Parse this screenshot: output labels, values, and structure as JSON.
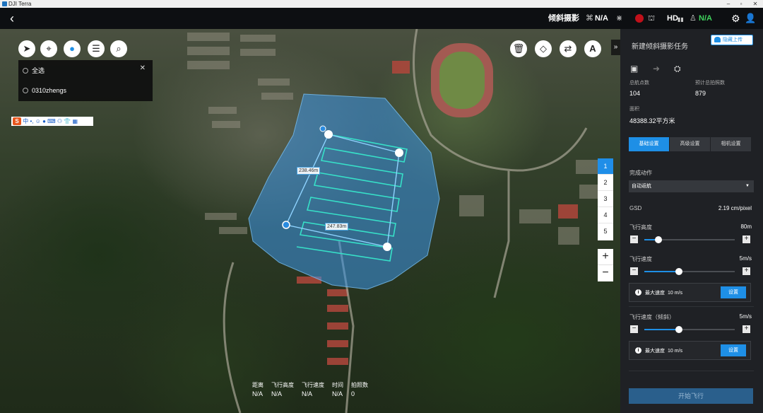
{
  "window": {
    "title": "DJI Terra",
    "min": "–",
    "restore": "▫",
    "close": "✕"
  },
  "topbar": {
    "back": "‹",
    "mode": "倾斜摄影",
    "gps_icon": "satellite-icon",
    "gps": "N/A",
    "signal_icon": "⋇",
    "rc_icon": "remote-controller-icon",
    "hd": "HD",
    "hd_bars": "▮▮",
    "battery_icon": "♙",
    "battery": "N/A",
    "settings_icon": "⚙",
    "user_icon": "👤",
    "colors": {
      "green": "#3fd35d",
      "red": "#c0101a"
    }
  },
  "map": {
    "tools": {
      "compass": "➤",
      "locate": "⌖",
      "pin": "●",
      "list": "☰",
      "search": "⌕"
    },
    "layers": {
      "select_all": "全选",
      "item": "0310zhengs",
      "close": "✕"
    },
    "ime": {
      "logo": "S",
      "text": "中 •, ☺ ● ⌨ ⚇ 👕 ▦"
    },
    "right_tools": {
      "delete": "🗑",
      "erase": "◇",
      "route": "⇄",
      "takeoff": "A"
    },
    "distances": {
      "edge1": "238.46m",
      "edge2": "247.83m"
    },
    "waypoints": [
      "1",
      "2",
      "3",
      "4",
      "5"
    ],
    "zoom": {
      "in": "+",
      "out": "−"
    },
    "stats": [
      {
        "label": "距离",
        "value": "N/A"
      },
      {
        "label": "飞行高度",
        "value": "N/A"
      },
      {
        "label": "飞行速度",
        "value": "N/A"
      },
      {
        "label": "时间",
        "value": "N/A"
      },
      {
        "label": "拍照数",
        "value": "0"
      }
    ],
    "collapse": "»"
  },
  "panel": {
    "title": "新建倾斜摄影任务",
    "upload": "隐藏上传",
    "tool_icons": {
      "save": "▣",
      "send": "➜",
      "settings": "⛭"
    },
    "waypoints_label": "总航点数",
    "waypoints_value": "104",
    "photos_label": "预计总拍照数",
    "photos_value": "879",
    "area_label": "面积",
    "area_value": "48388.32平方米",
    "tabs": [
      "基础设置",
      "高级设置",
      "相机设置"
    ],
    "finish_label": "完成动作",
    "finish_value": "自动返航",
    "gsd_label": "GSD",
    "gsd_value": "2.19 cm/pixel",
    "altitude_label": "飞行高度",
    "altitude_value": "80m",
    "altitude_fraction": 0.16,
    "speed_label": "飞行速度",
    "speed_value": "5m/s",
    "speed_fraction": 0.38,
    "max_speed_label": "最大速度",
    "max_speed_value": "10 m/s",
    "set_label": "设置",
    "oblique_speed_label": "飞行速度（倾斜）",
    "oblique_speed_value": "5m/s",
    "oblique_speed_fraction": 0.38,
    "start": "开始飞行",
    "accent": "#1e8fe6"
  }
}
